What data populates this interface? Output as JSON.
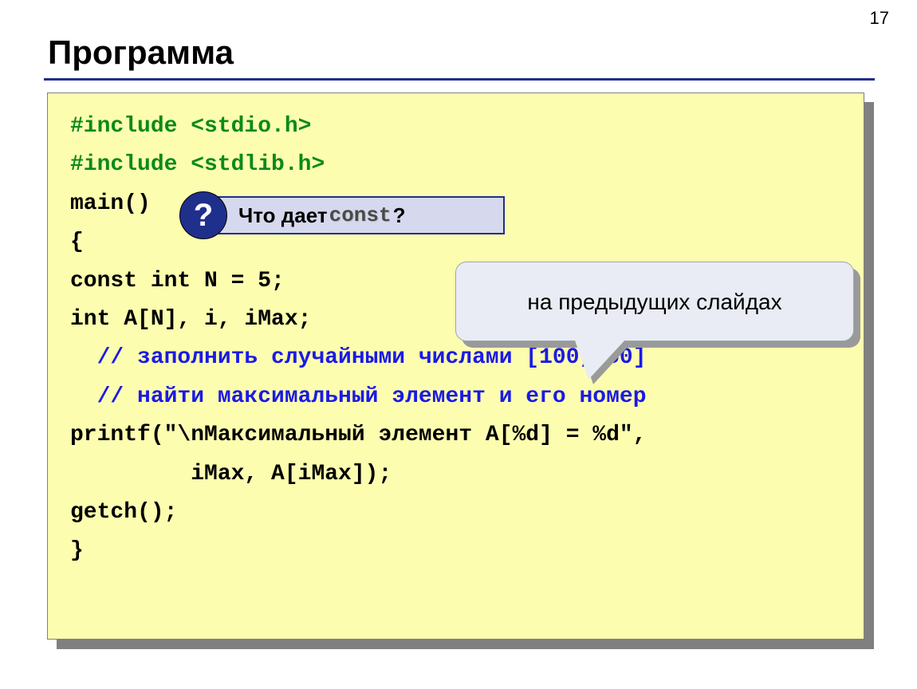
{
  "page_number": "17",
  "title": "Программа",
  "code": {
    "l1": "#include <stdio.h>",
    "l2": "#include <stdlib.h>",
    "l3": "main()",
    "l4": "{",
    "l5": "const int N = 5;",
    "l6": "int A[N], i, iMax;",
    "l7": "  // заполнить случайными числами [100,150]",
    "l8": "  // найти максимальный элемент и его номер",
    "l9": "printf(\"\\nМаксимальный элемент A[%d] = %d\",",
    "l10": "         iMax, A[iMax]);",
    "l11": "getch();",
    "l12": "}"
  },
  "callout": {
    "badge": "?",
    "prefix": "Что дает ",
    "keyword": "const",
    "suffix": "?"
  },
  "note": "на предыдущих слайдах"
}
